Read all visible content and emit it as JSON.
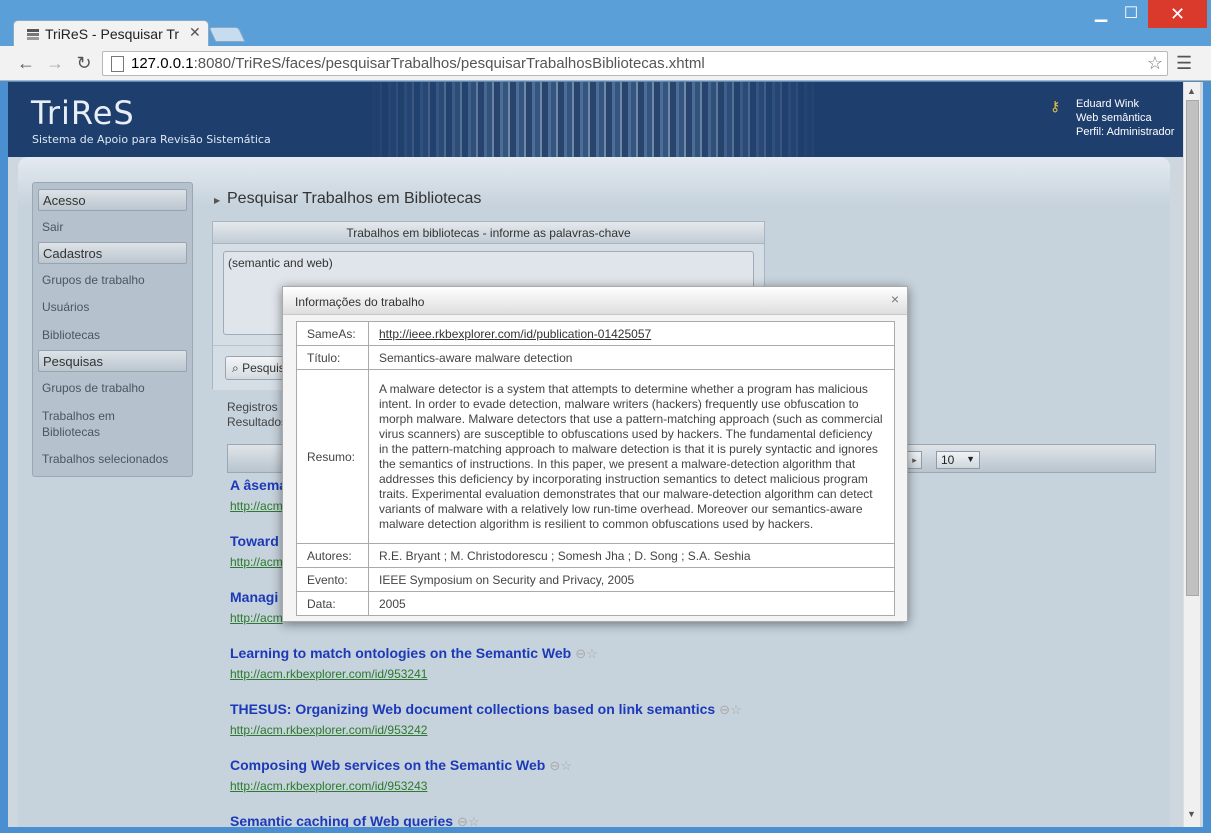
{
  "browser": {
    "tab_title": "TriReS - Pesquisar Tr",
    "url_host": "127.0.0.1",
    "url_rest": ":8080/TriReS/faces/pesquisarTrabalhos/pesquisarTrabalhosBibliotecas.xhtml"
  },
  "banner": {
    "brand": "TriReS",
    "subtitle": "Sistema de Apoio para Revisão Sistemática",
    "user_name": "Eduard Wink",
    "user_group": "Web semântica",
    "user_profile": "Perfil: Administrador"
  },
  "sidebar": {
    "acesso": "Acesso",
    "sair": "Sair",
    "cadastros": "Cadastros",
    "grupos_trabalho": "Grupos de trabalho",
    "usuarios": "Usuários",
    "bibliotecas": "Bibliotecas",
    "pesquisas": "Pesquisas",
    "pesq_grupos": "Grupos de trabalho",
    "trabalhos_bib_1": "Trabalhos em",
    "trabalhos_bib_2": "Bibliotecas",
    "trabalhos_sel": "Trabalhos selecionados"
  },
  "main": {
    "page_title": "Pesquisar Trabalhos em Bibliotecas",
    "search_header": "Trabalhos em bibliotecas - informe as palavras-chave",
    "search_value": "(semantic and web)",
    "search_button": "Pesquisar",
    "registros_label": "Registros",
    "resultados_label": "Resultados",
    "rows_per_page": "10"
  },
  "results": [
    {
      "title": "A âsema",
      "url": "http://acm"
    },
    {
      "title": "Toward",
      "url": "http://acm"
    },
    {
      "title": "Managi",
      "url": "http://acm"
    },
    {
      "title": "Learning to match ontologies on the Semantic Web",
      "url": "http://acm.rkbexplorer.com/id/953241"
    },
    {
      "title": "THESUS: Organizing Web document collections based on link semantics",
      "url": "http://acm.rkbexplorer.com/id/953242"
    },
    {
      "title": "Composing Web services on the Semantic Web",
      "url": "http://acm.rkbexplorer.com/id/953243"
    },
    {
      "title": "Semantic caching of Web queries",
      "url": ""
    }
  ],
  "modal": {
    "title": "Informações do trabalho",
    "close": "×",
    "labels": {
      "sameas": "SameAs:",
      "titulo": "Título:",
      "resumo": "Resumo:",
      "autores": "Autores:",
      "evento": "Evento:",
      "data": "Data:"
    },
    "sameas": "http://ieee.rkbexplorer.com/id/publication-01425057",
    "titulo": "Semantics-aware malware detection",
    "resumo": "A malware detector is a system that attempts to determine whether a program has malicious intent. In order to evade detection, malware writers (hackers) frequently use obfuscation to morph malware. Malware detectors that use a pattern-matching approach (such as commercial virus scanners) are susceptible to obfuscations used by hackers. The fundamental deficiency in the pattern-matching approach to malware detection is that it is purely syntactic and ignores the semantics of instructions. In this paper, we present a malware-detection algorithm that addresses this deficiency by incorporating instruction semantics to detect malicious program traits. Experimental evaluation demonstrates that our malware-detection algorithm can detect variants of malware with a relatively low run-time overhead. Moreover our semantics-aware malware detection algorithm is resilient to common obfuscations used by hackers.",
    "autores": "R.E. Bryant ; M. Christodorescu ; Somesh Jha ; D. Song ; S.A. Seshia",
    "evento": "IEEE Symposium on Security and Privacy, 2005",
    "data": "2005"
  }
}
